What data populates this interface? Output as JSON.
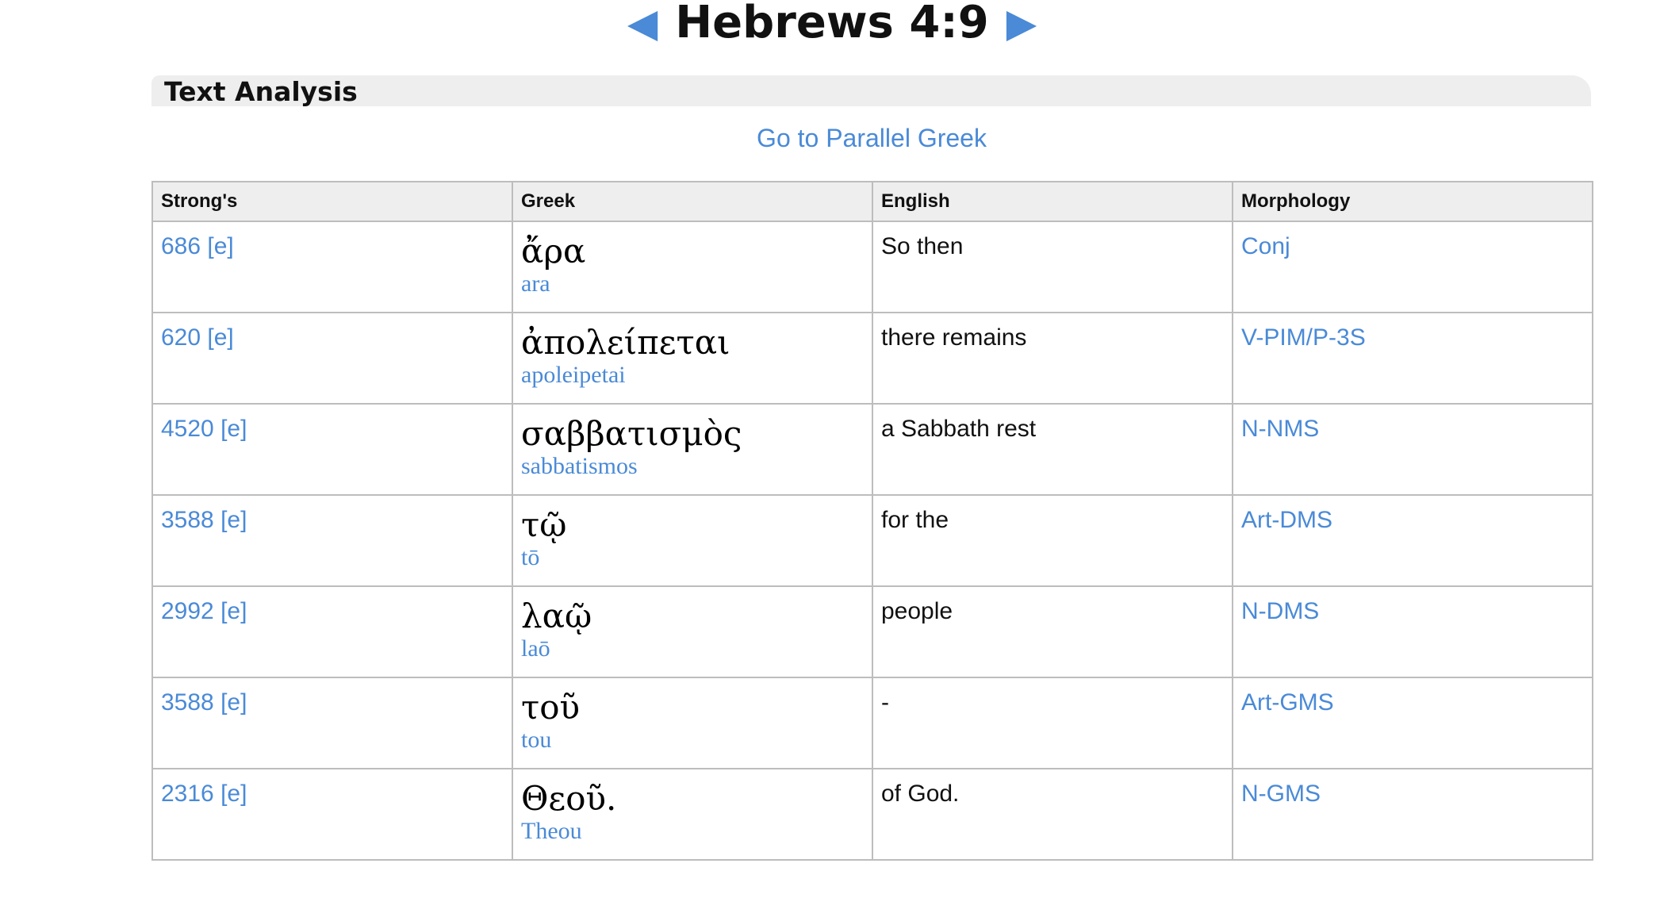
{
  "header": {
    "prev_arrow": "◀",
    "title": "Hebrews 4:9",
    "next_arrow": "▶"
  },
  "section": {
    "title": "Text Analysis",
    "parallel_link": "Go to Parallel Greek"
  },
  "table": {
    "headers": [
      "Strong's",
      "Greek",
      "English",
      "Morphology"
    ],
    "rows": [
      {
        "strongs": "686",
        "e": "[e]",
        "greek": "ἄρα",
        "translit": "ara",
        "english": "So then",
        "morph": "Conj"
      },
      {
        "strongs": "620",
        "e": "[e]",
        "greek": "ἀπολείπεται",
        "translit": "apoleipetai",
        "english": "there remains",
        "morph": "V-PIM/P-3S"
      },
      {
        "strongs": "4520",
        "e": "[e]",
        "greek": "σαββατισμὸς",
        "translit": "sabbatismos",
        "english": "a Sabbath rest",
        "morph": "N-NMS"
      },
      {
        "strongs": "3588",
        "e": "[e]",
        "greek": "τῷ",
        "translit": "tō",
        "english": "for the",
        "morph": "Art-DMS"
      },
      {
        "strongs": "2992",
        "e": "[e]",
        "greek": "λαῷ",
        "translit": "laō",
        "english": "people",
        "morph": "N-DMS"
      },
      {
        "strongs": "3588",
        "e": "[e]",
        "greek": "τοῦ",
        "translit": "tou",
        "english": "-",
        "morph": "Art-GMS"
      },
      {
        "strongs": "2316",
        "e": "[e]",
        "greek": "Θεοῦ.",
        "translit": "Theou",
        "english": "of God.",
        "morph": "N-GMS"
      }
    ]
  },
  "colors": {
    "link": "#4a8ad7",
    "header_bg": "#eeeeee",
    "border": "#bdbdbd"
  }
}
